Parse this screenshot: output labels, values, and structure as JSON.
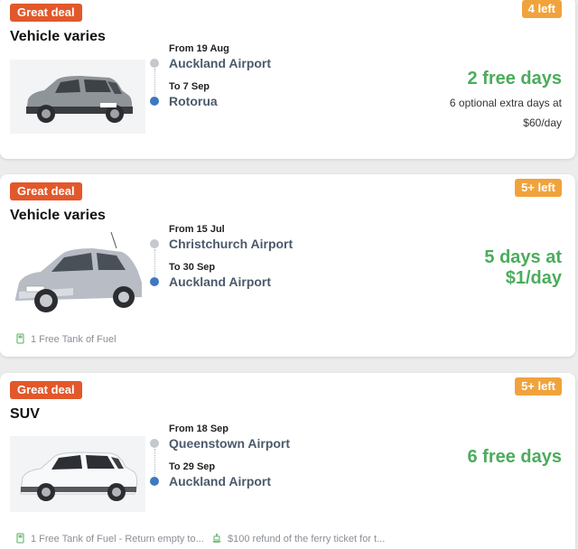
{
  "cards": [
    {
      "deal_badge": "Great deal",
      "availability": "4 left",
      "vehicle_type": "Vehicle varies",
      "pickup_date": "From 19 Aug",
      "pickup_location": "Auckland Airport",
      "dropoff_date": "To 7 Sep",
      "dropoff_location": "Rotorua",
      "price_headline": "2 free days",
      "price_detail_1": "6 optional extra days at",
      "price_detail_2": "$60/day",
      "car_icon": "compact-suv-car-image"
    },
    {
      "deal_badge": "Great deal",
      "availability": "5+ left",
      "vehicle_type": "Vehicle varies",
      "pickup_date": "From 15 Jul",
      "pickup_location": "Christchurch Airport",
      "dropoff_date": "To 30 Sep",
      "dropoff_location": "Auckland Airport",
      "price_headline_1": "5 days at",
      "price_headline_2": "$1/day",
      "features": [
        "1 Free Tank of Fuel"
      ],
      "car_icon": "hatchback-car-image"
    },
    {
      "deal_badge": "Great deal",
      "availability": "5+ left",
      "vehicle_type": "SUV",
      "pickup_date": "From 18 Sep",
      "pickup_location": "Queenstown Airport",
      "dropoff_date": "To 29 Sep",
      "dropoff_location": "Auckland Airport",
      "price_headline": "6 free days",
      "features": [
        "1 Free Tank of Fuel - Return empty to...",
        "$100 refund of the ferry ticket for t..."
      ],
      "car_icon": "suv-car-image"
    }
  ],
  "colors": {
    "deal_badge": "#e2582b",
    "availability_badge": "#f0a33c",
    "price_green": "#4aad5c",
    "location_text": "#4b5a6b",
    "pickup_dot": "#c5c8cc",
    "dropoff_dot": "#3f77c1"
  },
  "icons": {
    "fuel": "fuel-pump-icon",
    "ferry": "ferry-icon"
  }
}
